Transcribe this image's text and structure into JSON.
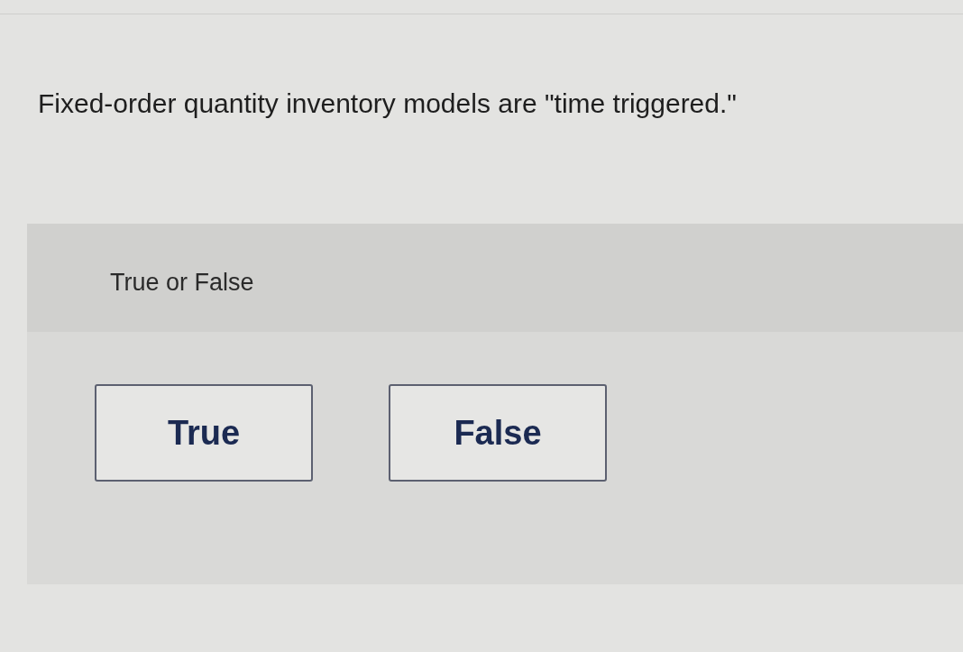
{
  "question": {
    "text": "Fixed-order quantity inventory models are \"time triggered.\""
  },
  "answer_panel": {
    "label": "True or False",
    "choices": [
      {
        "label": "True",
        "selected": false
      },
      {
        "label": "False",
        "selected": false
      }
    ]
  }
}
